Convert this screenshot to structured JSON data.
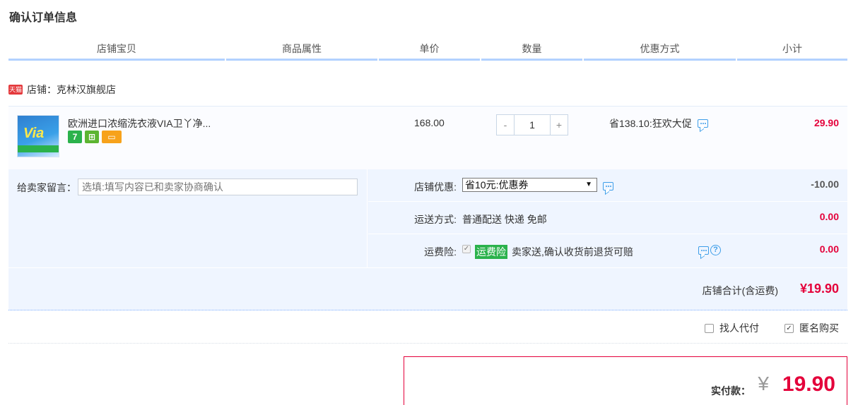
{
  "page": {
    "title": "确认订单信息"
  },
  "columns": [
    "店铺宝贝",
    "商品属性",
    "单价",
    "数量",
    "优惠方式",
    "小计"
  ],
  "shop": {
    "badge": "天猫",
    "label": "店铺：克林汉旗舰店"
  },
  "item": {
    "title": "欧洲进口浓缩洗衣液VIA卫丫净...",
    "thumb_text": "Via",
    "services": [
      "7",
      "⊞",
      "▭"
    ],
    "unit_price": "168.00",
    "qty_minus": "-",
    "quantity": "1",
    "qty_plus": "+",
    "promotion": "省138.10:狂欢大促",
    "subtotal": "29.90"
  },
  "note": {
    "label": "给卖家留言：",
    "placeholder": "选填:填写内容已和卖家协商确认"
  },
  "coupon": {
    "label": "店铺优惠:",
    "selected": "省10元:优惠券",
    "arrow": "▼",
    "amount": "-10.00"
  },
  "shipping": {
    "label": "运送方式:",
    "value": "普通配送 快递 免邮",
    "amount": "0.00"
  },
  "insurance": {
    "label": "运费险:",
    "tag": "运费险",
    "text": "卖家送,确认收货前退货可赔",
    "help": "?",
    "amount": "0.00"
  },
  "shop_total": {
    "label": "店铺合计(含运费)",
    "amount": "¥19.90"
  },
  "flags": {
    "proxy_pay": "找人代付",
    "anonymous": "匿名购买"
  },
  "payment": {
    "label": "实付款：",
    "currency": "¥",
    "amount": "19.90"
  },
  "colors": {
    "price_red": "#e4003a",
    "header_blue": "#b2d1ff",
    "row_bg": "#eff5ff",
    "icon_blue": "#3e9ee9",
    "green_tag": "#2bb24c"
  }
}
